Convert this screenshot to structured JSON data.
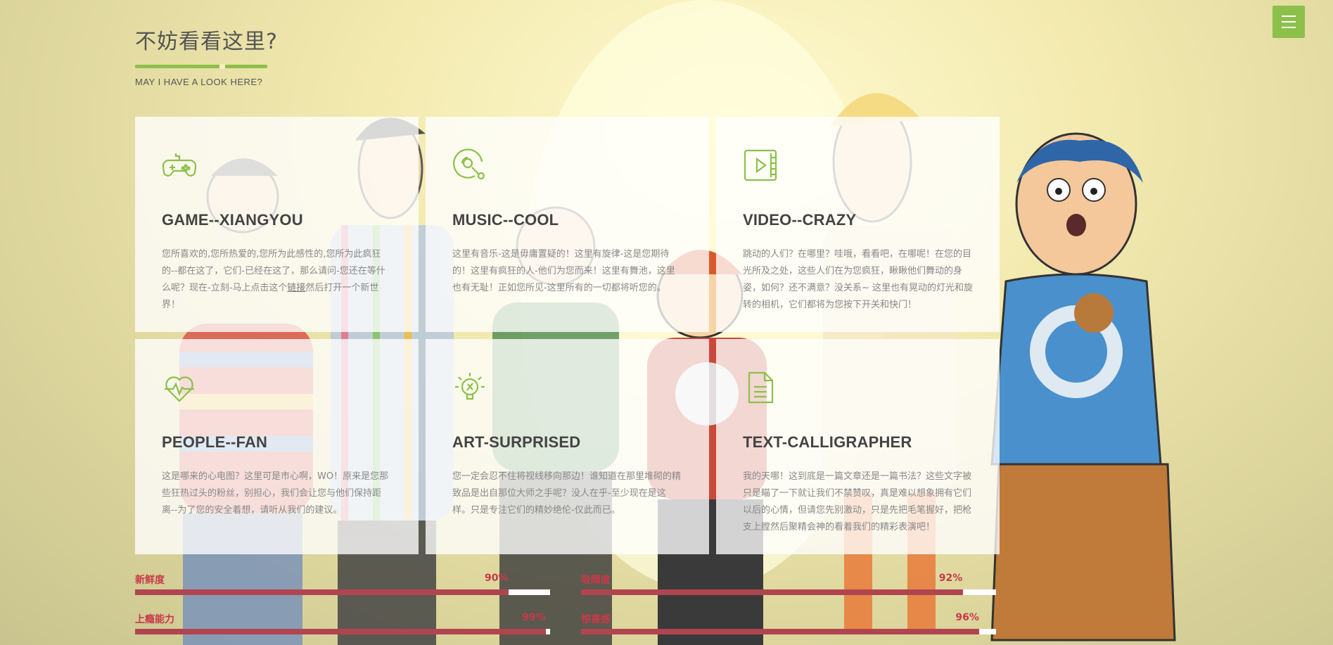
{
  "header": {
    "title": "不妨看看这里?",
    "subtitle": "MAY I HAVE A LOOK HERE?"
  },
  "menu": {
    "icon": "hamburger-icon"
  },
  "cards": [
    {
      "icon": "gamepad-icon",
      "title": "GAME--XIANGYOU",
      "text_before_link": "您所喜欢的,您所热爱的,您所为此感性的,您所为此疯狂的--都在这了，它们-已经在这了，那么请问-您还在等什么呢？现在-立刻-马上点击这个",
      "link": "链接",
      "text_after_link": "然后打开一个新世界！"
    },
    {
      "icon": "music-disc-icon",
      "title": "MUSIC--COOL",
      "text": "这里有音乐-这是毋庸置疑的！这里有旋律-这是您期待的！这里有疯狂的人-他们为您而来！这里有舞池，这里也有无耻！正如您所见-这里所有的一切都将听您的。"
    },
    {
      "icon": "video-play-icon",
      "title": "VIDEO--CRAZY",
      "text": "跳动的人们？在哪里？哇哦，看看吧，在哪呢！在您的目光所及之处，这些人们在为您疯狂，瞅瞅他们舞动的身姿，如何？还不满意？没关系~ 这里也有晃动的灯光和旋转的相机，它们都将为您按下开关和快门！"
    },
    {
      "icon": "heart-pulse-icon",
      "title": "PEOPLE--FAN",
      "text": "这是哪来的心电图？这里可是市心啊，WO！原来是您那些狂热过头的粉丝，别担心，我们会让您与他们保持距离--为了您的安全着想，请听从我们的建议。"
    },
    {
      "icon": "lightbulb-icon",
      "title": "ART-SURPRISED",
      "text": "您一定会忍不住将视线移向那边！谁知道在那里堆砌的精致品是出自那位大师之手呢？没人在乎-至少现在是这样。只是专注它们的精妙绝伦-仅此而已。"
    },
    {
      "icon": "document-icon",
      "title": "TEXT-CALLIGRAPHER",
      "text": "我的天哪！这到底是一篇文章还是一篇书法？这些文字被只是瞄了一下就让我们不禁赞叹，真是难以想象拥有它们以后的心情，但请您先别激动，只是先把毛笔握好，把枪支上膛然后聚精会神的看着我们的精彩表演吧！"
    }
  ],
  "skills": [
    {
      "label": "新鲜度",
      "value": 90,
      "display": "90%"
    },
    {
      "label": "吸睛度",
      "value": 92,
      "display": "92%"
    },
    {
      "label": "上瘾能力",
      "value": 99,
      "display": "99%"
    },
    {
      "label": "惊喜感",
      "value": 96,
      "display": "96%"
    }
  ],
  "colors": {
    "accent": "#8cc04a",
    "skill_text": "#c9394a",
    "skill_bar": "#b04550"
  }
}
